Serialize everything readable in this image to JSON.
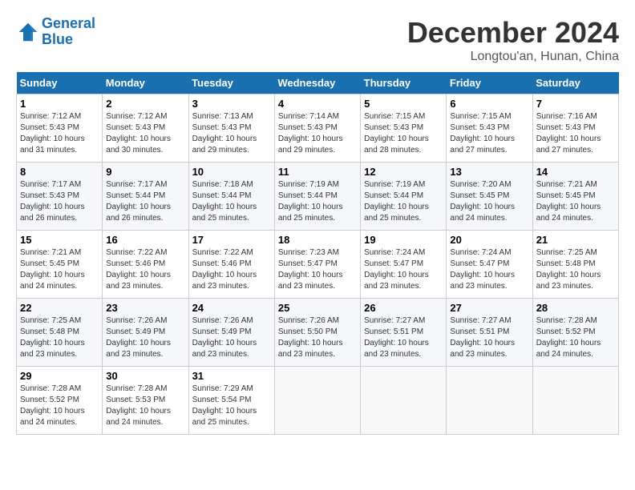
{
  "header": {
    "logo_line1": "General",
    "logo_line2": "Blue",
    "month": "December 2024",
    "location": "Longtou'an, Hunan, China"
  },
  "weekdays": [
    "Sunday",
    "Monday",
    "Tuesday",
    "Wednesday",
    "Thursday",
    "Friday",
    "Saturday"
  ],
  "weeks": [
    [
      {
        "day": "1",
        "sunrise": "7:12 AM",
        "sunset": "5:43 PM",
        "daylight": "10 hours and 31 minutes."
      },
      {
        "day": "2",
        "sunrise": "7:12 AM",
        "sunset": "5:43 PM",
        "daylight": "10 hours and 30 minutes."
      },
      {
        "day": "3",
        "sunrise": "7:13 AM",
        "sunset": "5:43 PM",
        "daylight": "10 hours and 29 minutes."
      },
      {
        "day": "4",
        "sunrise": "7:14 AM",
        "sunset": "5:43 PM",
        "daylight": "10 hours and 29 minutes."
      },
      {
        "day": "5",
        "sunrise": "7:15 AM",
        "sunset": "5:43 PM",
        "daylight": "10 hours and 28 minutes."
      },
      {
        "day": "6",
        "sunrise": "7:15 AM",
        "sunset": "5:43 PM",
        "daylight": "10 hours and 27 minutes."
      },
      {
        "day": "7",
        "sunrise": "7:16 AM",
        "sunset": "5:43 PM",
        "daylight": "10 hours and 27 minutes."
      }
    ],
    [
      {
        "day": "8",
        "sunrise": "7:17 AM",
        "sunset": "5:43 PM",
        "daylight": "10 hours and 26 minutes."
      },
      {
        "day": "9",
        "sunrise": "7:17 AM",
        "sunset": "5:44 PM",
        "daylight": "10 hours and 26 minutes."
      },
      {
        "day": "10",
        "sunrise": "7:18 AM",
        "sunset": "5:44 PM",
        "daylight": "10 hours and 25 minutes."
      },
      {
        "day": "11",
        "sunrise": "7:19 AM",
        "sunset": "5:44 PM",
        "daylight": "10 hours and 25 minutes."
      },
      {
        "day": "12",
        "sunrise": "7:19 AM",
        "sunset": "5:44 PM",
        "daylight": "10 hours and 25 minutes."
      },
      {
        "day": "13",
        "sunrise": "7:20 AM",
        "sunset": "5:45 PM",
        "daylight": "10 hours and 24 minutes."
      },
      {
        "day": "14",
        "sunrise": "7:21 AM",
        "sunset": "5:45 PM",
        "daylight": "10 hours and 24 minutes."
      }
    ],
    [
      {
        "day": "15",
        "sunrise": "7:21 AM",
        "sunset": "5:45 PM",
        "daylight": "10 hours and 24 minutes."
      },
      {
        "day": "16",
        "sunrise": "7:22 AM",
        "sunset": "5:46 PM",
        "daylight": "10 hours and 23 minutes."
      },
      {
        "day": "17",
        "sunrise": "7:22 AM",
        "sunset": "5:46 PM",
        "daylight": "10 hours and 23 minutes."
      },
      {
        "day": "18",
        "sunrise": "7:23 AM",
        "sunset": "5:47 PM",
        "daylight": "10 hours and 23 minutes."
      },
      {
        "day": "19",
        "sunrise": "7:24 AM",
        "sunset": "5:47 PM",
        "daylight": "10 hours and 23 minutes."
      },
      {
        "day": "20",
        "sunrise": "7:24 AM",
        "sunset": "5:47 PM",
        "daylight": "10 hours and 23 minutes."
      },
      {
        "day": "21",
        "sunrise": "7:25 AM",
        "sunset": "5:48 PM",
        "daylight": "10 hours and 23 minutes."
      }
    ],
    [
      {
        "day": "22",
        "sunrise": "7:25 AM",
        "sunset": "5:48 PM",
        "daylight": "10 hours and 23 minutes."
      },
      {
        "day": "23",
        "sunrise": "7:26 AM",
        "sunset": "5:49 PM",
        "daylight": "10 hours and 23 minutes."
      },
      {
        "day": "24",
        "sunrise": "7:26 AM",
        "sunset": "5:49 PM",
        "daylight": "10 hours and 23 minutes."
      },
      {
        "day": "25",
        "sunrise": "7:26 AM",
        "sunset": "5:50 PM",
        "daylight": "10 hours and 23 minutes."
      },
      {
        "day": "26",
        "sunrise": "7:27 AM",
        "sunset": "5:51 PM",
        "daylight": "10 hours and 23 minutes."
      },
      {
        "day": "27",
        "sunrise": "7:27 AM",
        "sunset": "5:51 PM",
        "daylight": "10 hours and 23 minutes."
      },
      {
        "day": "28",
        "sunrise": "7:28 AM",
        "sunset": "5:52 PM",
        "daylight": "10 hours and 24 minutes."
      }
    ],
    [
      {
        "day": "29",
        "sunrise": "7:28 AM",
        "sunset": "5:52 PM",
        "daylight": "10 hours and 24 minutes."
      },
      {
        "day": "30",
        "sunrise": "7:28 AM",
        "sunset": "5:53 PM",
        "daylight": "10 hours and 24 minutes."
      },
      {
        "day": "31",
        "sunrise": "7:29 AM",
        "sunset": "5:54 PM",
        "daylight": "10 hours and 25 minutes."
      },
      null,
      null,
      null,
      null
    ]
  ]
}
